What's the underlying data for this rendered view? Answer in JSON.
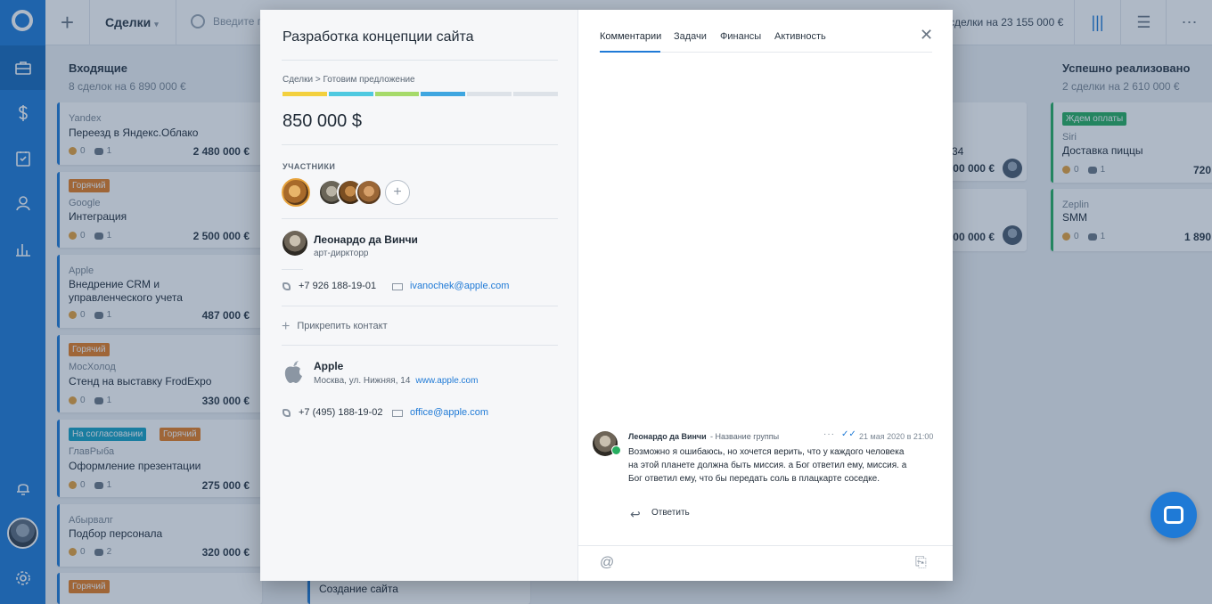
{
  "topbar": {
    "pipeline_label": "Сделки",
    "search_placeholder": "Введите п",
    "summary": "сделки на 23 155 000 €"
  },
  "board": {
    "left_column": {
      "title": "Входящие",
      "subtitle": "8 сделок на 6 890 000 €",
      "cards": [
        {
          "company": "Yandex",
          "title": "Переезд в Яндекс.Облако",
          "tasks": "0",
          "comments": "1",
          "amount": "2 480 000 €"
        },
        {
          "badges": [
            "Горячий"
          ],
          "company": "Google",
          "title": "Интеграция",
          "tasks": "0",
          "comments": "1",
          "amount": "2 500 000 €"
        },
        {
          "company": "Apple",
          "title": "Внедрение CRM и управленческого учета",
          "tasks": "0",
          "comments": "1",
          "amount": "487 000 €"
        },
        {
          "badges": [
            "Горячий"
          ],
          "company": "МосХолод",
          "title": "Стенд на выставку FrodExpo",
          "tasks": "0",
          "comments": "1",
          "amount": "330 000 €"
        },
        {
          "badges": [
            "На согласовании",
            "Горячий"
          ],
          "company": "ГлавРыба",
          "title": "Оформление презентации",
          "tasks": "0",
          "comments": "1",
          "amount": "275 000 €"
        },
        {
          "company": "Абырвалг",
          "title": "Подбор персонала",
          "tasks": "0",
          "comments": "2",
          "amount": "320 000 €"
        },
        {
          "badges": [
            "Горячий"
          ]
        }
      ]
    },
    "middle_fragments": {
      "amount1": "00 000 €",
      "amount2": "00 000 €",
      "number": "34",
      "bottom_card_title": "Создание сайта"
    },
    "right_column": {
      "title": "Успешно реализовано",
      "subtitle": "2 сделки на 2 610 000 €",
      "cards": [
        {
          "badges": [
            "Ждем оплаты"
          ],
          "company": "Siri",
          "title": "Доставка пиццы",
          "tasks": "0",
          "comments": "1",
          "amount": "720"
        },
        {
          "company": "Zeplin",
          "title": "SMM",
          "tasks": "0",
          "comments": "1",
          "amount": "1 890"
        }
      ]
    }
  },
  "modal": {
    "title": "Разработка концепции сайта",
    "breadcrumb": "Сделки > Готовим предложение",
    "stages": [
      "#f3d03e",
      "#4fc9e0",
      "#a6da6a",
      "#3fa6e0",
      "#dde2e8",
      "#dde2e8"
    ],
    "price": "850 000 $",
    "participants_label": "УЧАСТНИКИ",
    "contact": {
      "name": "Леонардо да Винчи",
      "role": "арт-диркторр",
      "phone": "+7 926 188-19-01",
      "email": "ivanochek@apple.com"
    },
    "attach_label": "Прикрепить контакт",
    "company": {
      "name": "Apple",
      "address": "Москва, ул. Нижняя, 14",
      "site": "www.apple.com",
      "phone": "+7 (495) 188-19-02",
      "email": "office@apple.com"
    },
    "tabs": [
      "Комментарии",
      "Задачи",
      "Финансы",
      "Активность"
    ],
    "message": {
      "author": "Леонардо да Винчи",
      "group": "- Название группы",
      "time": "21 мая 2020 в 21:00",
      "text": "Возможно я ошибаюсь, но хочется верить, что у каждого человека на этой планете должна быть миссия.  а Бог ответил ему, миссия.  а Бог ответил ему, что бы передать соль в плацкарте соседке.",
      "reply_label": "Ответить"
    }
  },
  "icons": {
    "close": "close-icon",
    "at": "at-icon",
    "attach": "paperclip-icon"
  }
}
